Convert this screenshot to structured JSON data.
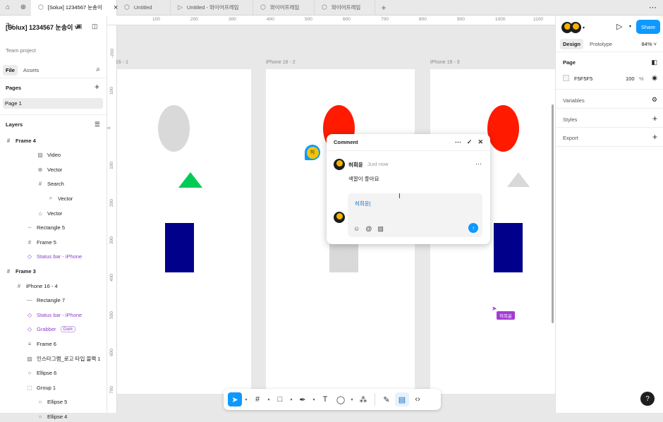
{
  "tabs": [
    {
      "label": "[Solux] 1234567 눈송이",
      "active": true
    },
    {
      "label": "Untitled"
    },
    {
      "label": "Untitled - 와이어프레임"
    },
    {
      "label": "와이어프레임"
    },
    {
      "label": "와이어프레임"
    }
  ],
  "file": {
    "title": "[Solux] 1234567 눈송이",
    "subtitle": "Team project"
  },
  "left_tabs": {
    "file": "File",
    "assets": "Assets"
  },
  "pages": {
    "header": "Pages",
    "items": [
      "Page 1"
    ]
  },
  "layers": {
    "header": "Layers",
    "items": [
      {
        "label": "Frame 4",
        "icon": "frame-icon",
        "depth": 0,
        "bold": true
      },
      {
        "label": "Video",
        "icon": "image-icon",
        "depth": 3
      },
      {
        "label": "Vector",
        "icon": "globe-icon",
        "depth": 3
      },
      {
        "label": "Search",
        "icon": "frame-icon",
        "depth": 3
      },
      {
        "label": "Vector",
        "icon": "search-icon",
        "depth": 4
      },
      {
        "label": "Vector",
        "icon": "home-icon",
        "depth": 3
      },
      {
        "label": "Rectangle 5",
        "icon": "dashed-line-icon",
        "depth": 2
      },
      {
        "label": "Frame 5",
        "icon": "frame-icon",
        "depth": 2
      },
      {
        "label": "Status bar - iPhone",
        "icon": "component-icon",
        "depth": 2,
        "purple": true
      },
      {
        "label": "Frame 3",
        "icon": "frame-icon",
        "depth": 0,
        "bold": true
      },
      {
        "label": "iPhone 16 - 4",
        "icon": "frame-icon",
        "depth": 1
      },
      {
        "label": "Rectangle 7",
        "icon": "line-icon",
        "depth": 2
      },
      {
        "label": "Status bar - iPhone",
        "icon": "component-icon",
        "depth": 2,
        "purple": true
      },
      {
        "label": "Grabber",
        "icon": "component-icon",
        "depth": 2,
        "purple": true,
        "badge": "Dark"
      },
      {
        "label": "Frame 6",
        "icon": "auto-layout-icon",
        "depth": 2
      },
      {
        "label": "인스타그램_로고 타입 블랙 1",
        "icon": "image-icon",
        "depth": 2
      },
      {
        "label": "Ellipse 6",
        "icon": "ellipse-icon",
        "depth": 2
      },
      {
        "label": "Group 1",
        "icon": "group-icon",
        "depth": 2
      },
      {
        "label": "Ellipse 5",
        "icon": "ellipse-icon",
        "depth": 3
      },
      {
        "label": "Ellipse 4",
        "icon": "ellipse-icon",
        "depth": 3
      }
    ]
  },
  "ruler": {
    "top": [
      "100",
      "200",
      "300",
      "400",
      "500",
      "600",
      "700",
      "800",
      "900",
      "1000",
      "1100"
    ],
    "left": [
      "-200",
      "100",
      "0",
      "100",
      "200",
      "300",
      "400",
      "500",
      "600",
      "700"
    ]
  },
  "frames": [
    "16 - 1",
    "iPhone 16 - 2",
    "iPhone 16 - 3"
  ],
  "comment": {
    "title": "Comment",
    "author": "허희윤",
    "time": "Just now",
    "text": "색깔이 좋아요",
    "reply_value": "허희윤",
    "pin_initial": "허"
  },
  "cursor_label": "허희윤",
  "right_panel": {
    "tabs": [
      "Design",
      "Prototype"
    ],
    "zoom": "84%",
    "share": "Share",
    "page_header": "Page",
    "page_color": "F5F5F5",
    "page_opacity": "100",
    "percent": "%",
    "variables": "Variables",
    "styles": "Styles",
    "export": "Export"
  },
  "colors": {
    "accent": "#0d99ff",
    "red": "#ff1a00",
    "navy": "#00008b",
    "green": "#00cc55",
    "gray": "#d9d9d9"
  }
}
